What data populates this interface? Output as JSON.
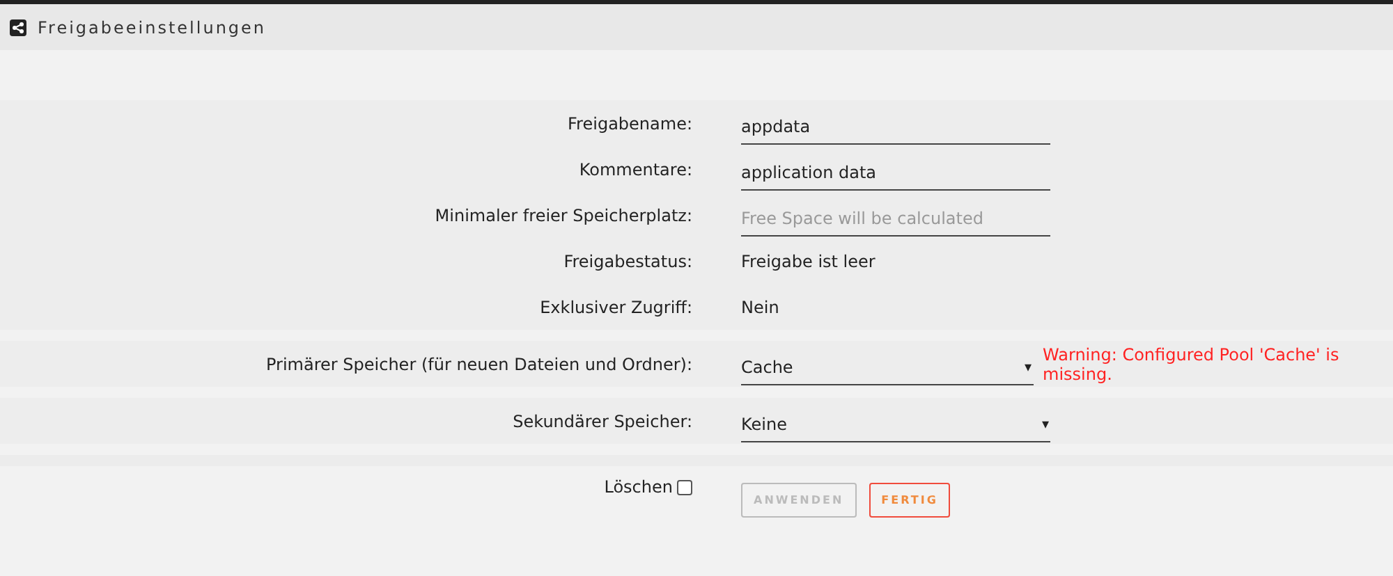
{
  "header": {
    "title": "Freigabeeinstellungen"
  },
  "sections": [
    {
      "rows": [
        {
          "label": "Freigabename:",
          "kind": "field",
          "value": "appdata"
        },
        {
          "label": "Kommentare:",
          "kind": "field",
          "value": "application data"
        },
        {
          "label": "Minimaler freier Speicherplatz:",
          "kind": "field",
          "placeholder": "Free Space will be calculated"
        },
        {
          "label": "Freigabestatus:",
          "kind": "text",
          "value": "Freigabe ist leer"
        },
        {
          "label": "Exklusiver Zugriff:",
          "kind": "text",
          "value": "Nein"
        }
      ]
    },
    {
      "rows": [
        {
          "label": "Primärer Speicher (für neuen Dateien und Ordner):",
          "kind": "select",
          "value": "Cache",
          "arrow": "▾",
          "warning": "Warning: Configured Pool 'Cache' is missing."
        }
      ]
    },
    {
      "rows": [
        {
          "label": "Sekundärer Speicher:",
          "kind": "select",
          "value": "Keine",
          "arrow": "▾"
        }
      ]
    }
  ],
  "footer": {
    "checkbox": {
      "label": "Löschen",
      "checked": false
    },
    "buttons": [
      {
        "label": "ANWENDEN",
        "disabled": true
      },
      {
        "label": "FERTIG",
        "disabled": false
      }
    ]
  }
}
